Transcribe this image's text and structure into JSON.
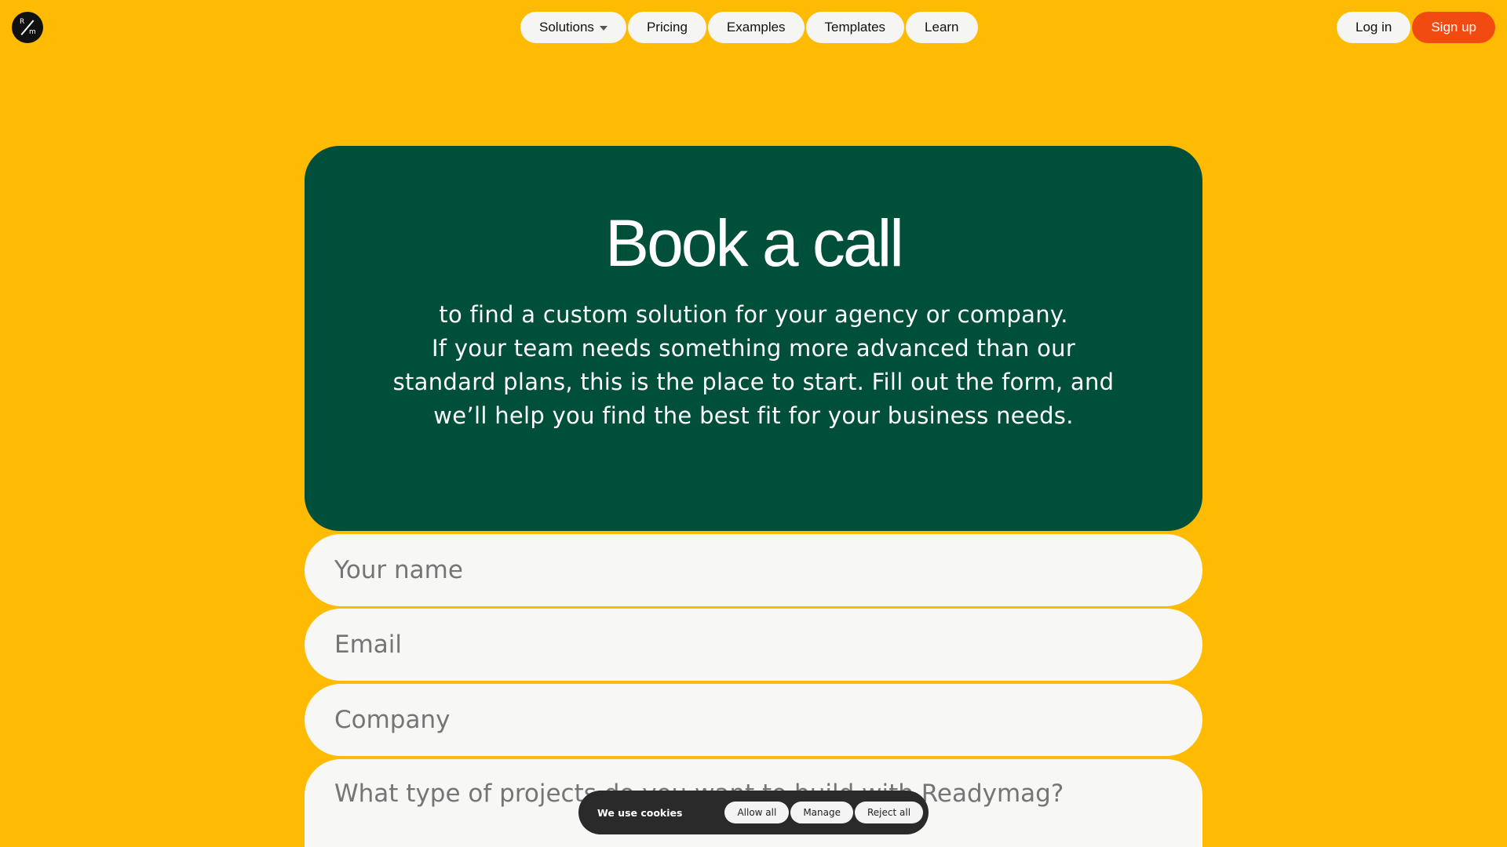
{
  "logo": {
    "top": "R",
    "bottom": "m"
  },
  "nav": {
    "items": [
      {
        "label": "Solutions"
      },
      {
        "label": "Pricing"
      },
      {
        "label": "Examples"
      },
      {
        "label": "Templates"
      },
      {
        "label": "Learn"
      }
    ]
  },
  "auth": {
    "login_label": "Log in",
    "signup_label": "Sign up"
  },
  "hero": {
    "title": "Book a call",
    "lead": "to find a custom solution for your agency or company.",
    "body": "If your team needs something more advanced than our standard plans, this is the place to start. Fill out the form, and we’ll help you find the best fit for your business needs."
  },
  "form": {
    "name_placeholder": "Your name",
    "email_placeholder": "Email",
    "company_placeholder": "Company",
    "projects_placeholder": "What type of projects do you want to build with Readymag?"
  },
  "cookies": {
    "label": "We use cookies",
    "allow_label": "Allow all",
    "manage_label": "Manage",
    "reject_label": "Reject all"
  },
  "colors": {
    "background": "#FFBB02",
    "hero": "#004F3A",
    "signup": "#F24B12"
  }
}
